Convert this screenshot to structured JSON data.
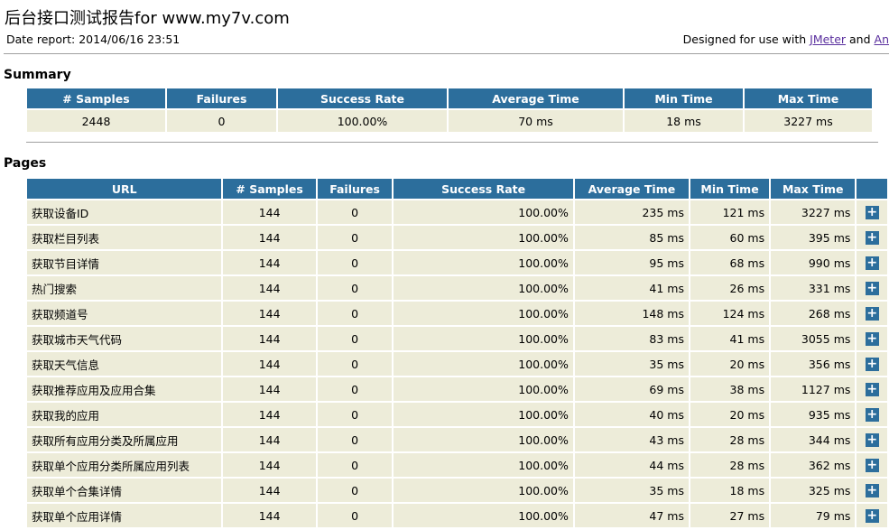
{
  "header": {
    "title": "后台接口测试报告for www.my7v.com",
    "date_report": "Date report: 2014/06/16 23:51",
    "designed_prefix": "Designed for use with ",
    "jmeter_link": "JMeter",
    "and_text": " and ",
    "ant_link": "An"
  },
  "summary": {
    "heading": "Summary",
    "columns": [
      "# Samples",
      "Failures",
      "Success Rate",
      "Average Time",
      "Min Time",
      "Max Time"
    ],
    "row": [
      "2448",
      "0",
      "100.00%",
      "70 ms",
      "18 ms",
      "3227 ms"
    ]
  },
  "pages": {
    "heading": "Pages",
    "columns": [
      "URL",
      "# Samples",
      "Failures",
      "Success Rate",
      "Average Time",
      "Min Time",
      "Max Time"
    ],
    "rows": [
      [
        "获取设备ID",
        "144",
        "0",
        "100.00%",
        "235 ms",
        "121 ms",
        "3227 ms"
      ],
      [
        "获取栏目列表",
        "144",
        "0",
        "100.00%",
        "85 ms",
        "60 ms",
        "395 ms"
      ],
      [
        "获取节目详情",
        "144",
        "0",
        "100.00%",
        "95 ms",
        "68 ms",
        "990 ms"
      ],
      [
        "热门搜索",
        "144",
        "0",
        "100.00%",
        "41 ms",
        "26 ms",
        "331 ms"
      ],
      [
        "获取频道号",
        "144",
        "0",
        "100.00%",
        "148 ms",
        "124 ms",
        "268 ms"
      ],
      [
        "获取城市天气代码",
        "144",
        "0",
        "100.00%",
        "83 ms",
        "41 ms",
        "3055 ms"
      ],
      [
        "获取天气信息",
        "144",
        "0",
        "100.00%",
        "35 ms",
        "20 ms",
        "356 ms"
      ],
      [
        "获取推荐应用及应用合集",
        "144",
        "0",
        "100.00%",
        "69 ms",
        "38 ms",
        "1127 ms"
      ],
      [
        "获取我的应用",
        "144",
        "0",
        "100.00%",
        "40 ms",
        "20 ms",
        "935 ms"
      ],
      [
        "获取所有应用分类及所属应用",
        "144",
        "0",
        "100.00%",
        "43 ms",
        "28 ms",
        "344 ms"
      ],
      [
        "获取单个应用分类所属应用列表",
        "144",
        "0",
        "100.00%",
        "44 ms",
        "28 ms",
        "362 ms"
      ],
      [
        "获取单个合集详情",
        "144",
        "0",
        "100.00%",
        "35 ms",
        "18 ms",
        "325 ms"
      ],
      [
        "获取单个应用详情",
        "144",
        "0",
        "100.00%",
        "47 ms",
        "27 ms",
        "79 ms"
      ]
    ],
    "expand_symbol": "+"
  }
}
